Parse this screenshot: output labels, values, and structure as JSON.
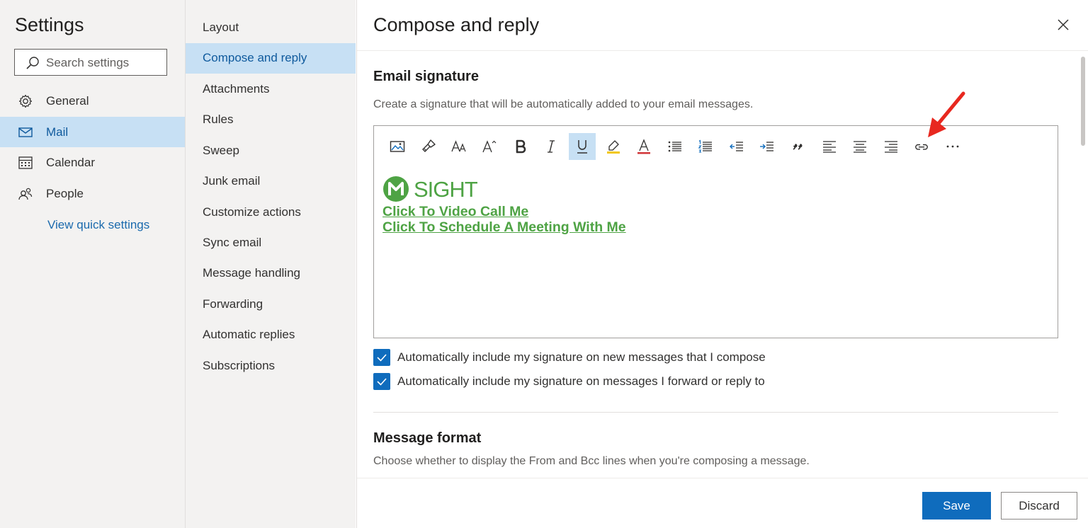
{
  "left_nav": {
    "title": "Settings",
    "search_placeholder": "Search settings",
    "items": [
      {
        "label": "General",
        "icon": "gear-icon"
      },
      {
        "label": "Mail",
        "icon": "mail-icon",
        "active": true
      },
      {
        "label": "Calendar",
        "icon": "calendar-icon"
      },
      {
        "label": "People",
        "icon": "people-icon"
      }
    ],
    "quick_settings_link": "View quick settings"
  },
  "sub_nav": {
    "items": [
      {
        "label": "Layout"
      },
      {
        "label": "Compose and reply",
        "active": true
      },
      {
        "label": "Attachments"
      },
      {
        "label": "Rules"
      },
      {
        "label": "Sweep"
      },
      {
        "label": "Junk email"
      },
      {
        "label": "Customize actions"
      },
      {
        "label": "Sync email"
      },
      {
        "label": "Message handling"
      },
      {
        "label": "Forwarding"
      },
      {
        "label": "Automatic replies"
      },
      {
        "label": "Subscriptions"
      }
    ]
  },
  "main": {
    "title": "Compose and reply",
    "signature": {
      "heading": "Email signature",
      "description": "Create a signature that will be automatically added to your email messages.",
      "toolbar": [
        "insert-picture-icon",
        "format-painter-icon",
        "font-size-icon",
        "grow-font-icon",
        "bold-icon",
        "italic-icon",
        "underline-icon",
        "highlight-icon",
        "font-color-icon",
        "bullets-icon",
        "numbering-icon",
        "decrease-indent-icon",
        "increase-indent-icon",
        "quote-icon",
        "align-left-icon",
        "align-center-icon",
        "align-right-icon",
        "insert-link-icon",
        "more-options-icon"
      ],
      "content": {
        "logo_text": "SIGHT",
        "link_1": "Click To Video Call Me",
        "link_2": "Click To Schedule A Meeting With Me"
      },
      "checkboxes": [
        {
          "label": "Automatically include my signature on new messages that I compose",
          "checked": true
        },
        {
          "label": "Automatically include my signature on messages I forward or reply to",
          "checked": true
        }
      ]
    },
    "message_format": {
      "heading": "Message format",
      "description": "Choose whether to display the From and Bcc lines when you're composing a message."
    },
    "footer": {
      "save_label": "Save",
      "discard_label": "Discard"
    }
  },
  "colors": {
    "accent": "#0f6cbd",
    "nav_selected": "#c7e0f4",
    "signature_green": "#4ea344",
    "annotation_arrow": "#e8281f"
  }
}
